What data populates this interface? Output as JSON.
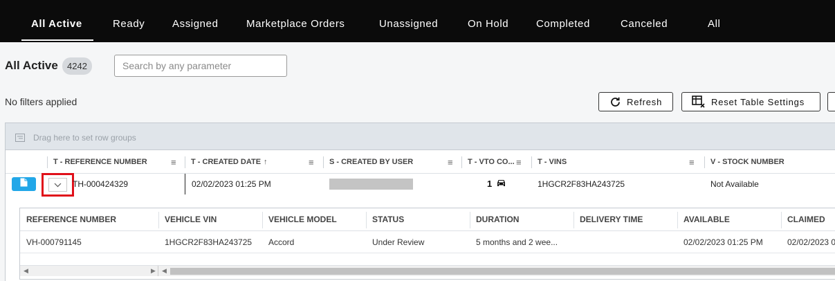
{
  "nav": {
    "tabs": [
      {
        "label": "All Active",
        "active": true
      },
      {
        "label": "Ready"
      },
      {
        "label": "Assigned"
      },
      {
        "label": "Marketplace Orders"
      },
      {
        "label": "Unassigned"
      },
      {
        "label": "On Hold"
      },
      {
        "label": "Completed"
      },
      {
        "label": "Canceled"
      },
      {
        "label": "All"
      }
    ]
  },
  "page": {
    "title": "All Active",
    "count": "4242",
    "search_placeholder": "Search by any parameter",
    "filters_text": "No filters applied"
  },
  "toolbar": {
    "refresh_label": "Refresh",
    "reset_label": "Reset Table Settings"
  },
  "grid": {
    "group_hint": "Drag here to set row groups",
    "columns": [
      "T - REFERENCE NUMBER",
      "T - CREATED DATE",
      "S - CREATED BY USER",
      "T - VTO CO...",
      "T - VINS",
      "V - STOCK NUMBER"
    ],
    "sort_indicator": "↑",
    "row": {
      "reference": "TH-000424329",
      "created_date": "02/02/2023 01:25 PM",
      "vto_count": "1",
      "vins": "1HGCR2F83HA243725",
      "stock_number": "Not Available"
    }
  },
  "detail": {
    "columns": [
      "REFERENCE NUMBER",
      "VEHICLE VIN",
      "VEHICLE MODEL",
      "STATUS",
      "DURATION",
      "DELIVERY TIME",
      "AVAILABLE",
      "CLAIMED"
    ],
    "row": {
      "reference": "VH-000791145",
      "vin": "1HGCR2F83HA243725",
      "model": "Accord",
      "status": "Under Review",
      "duration": "5 months and 2 wee...",
      "delivery_time": "",
      "available": "02/02/2023 01:25 PM",
      "claimed": "02/02/2023 0"
    }
  },
  "colors": {
    "nav_bg": "#0b0b0b",
    "accent": "#22a7e8",
    "highlight": "#e0101a"
  }
}
